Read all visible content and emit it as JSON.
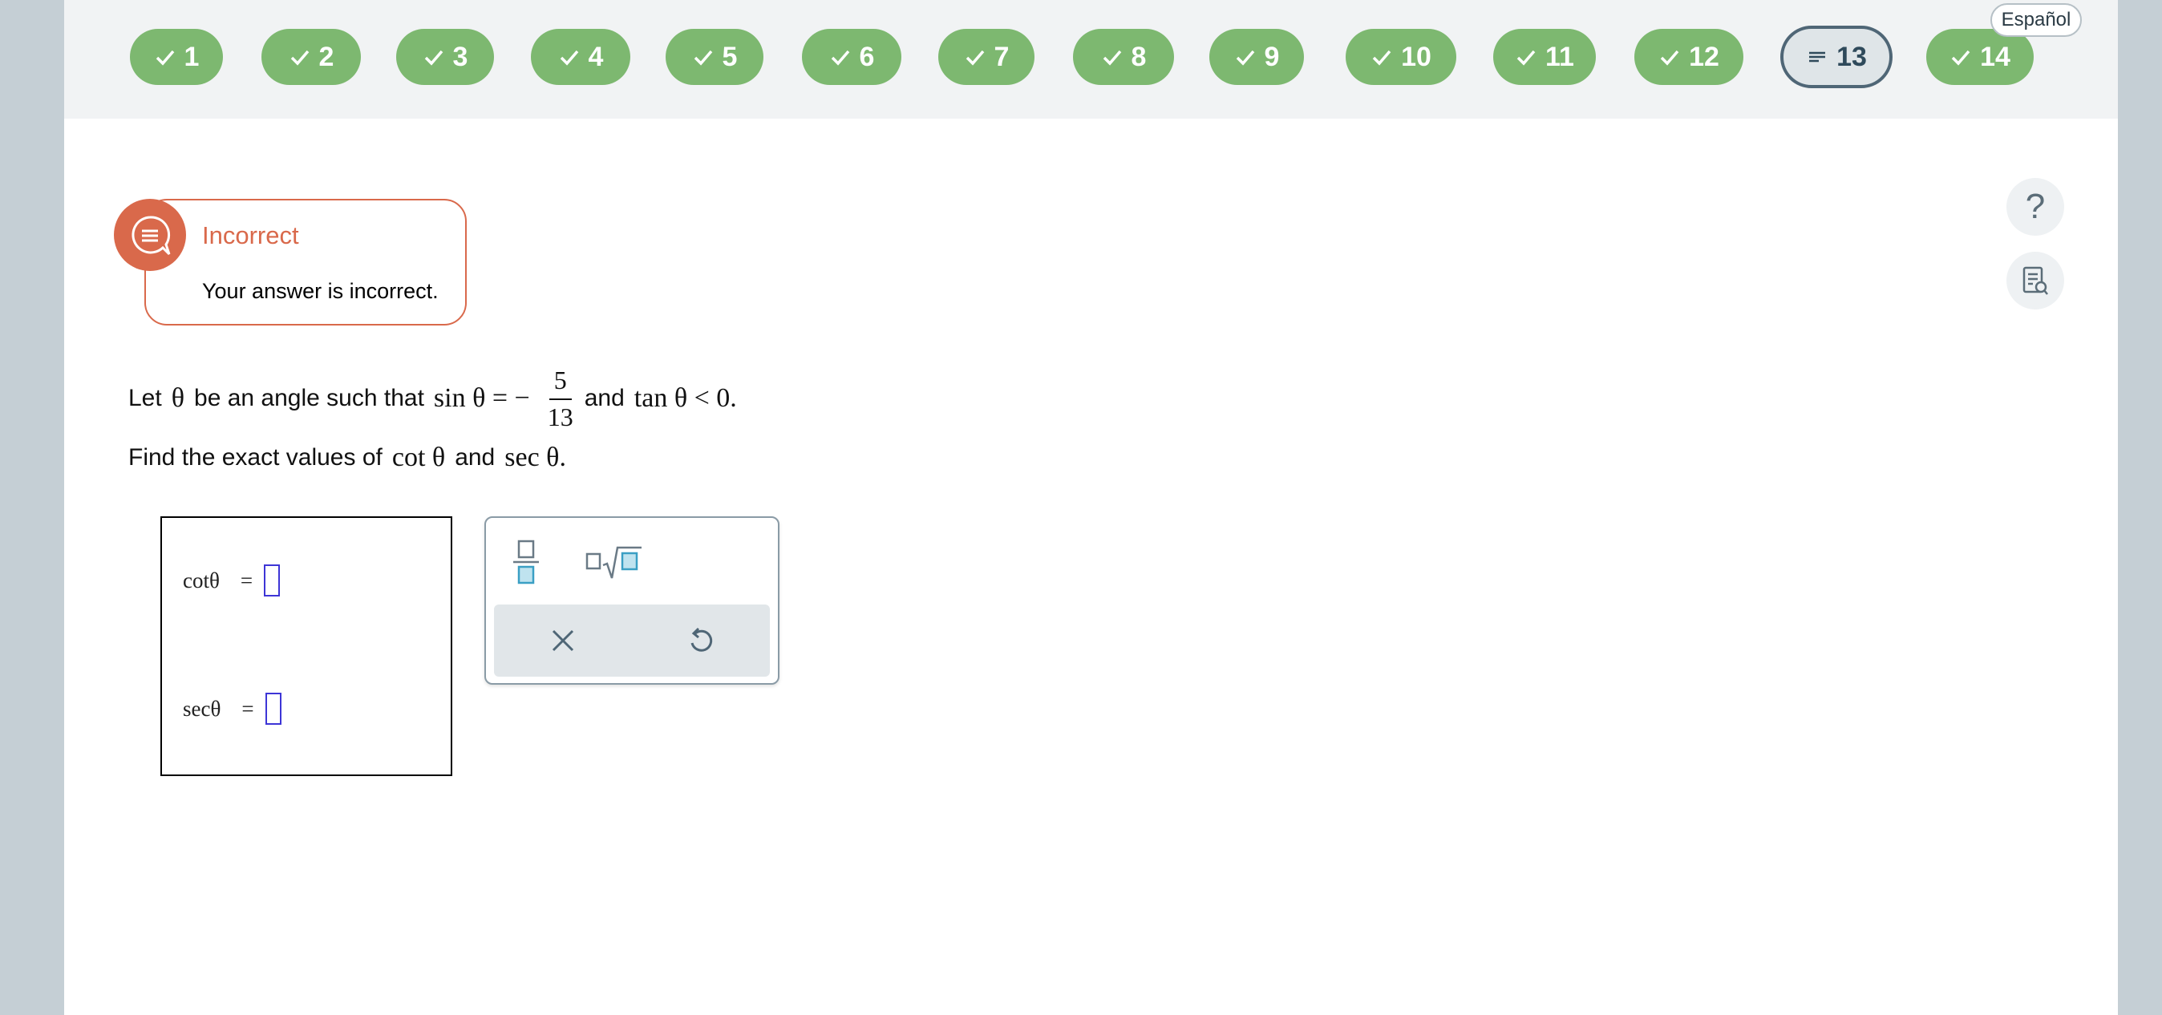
{
  "header": {
    "questions": [
      {
        "label": "1",
        "status": "correct"
      },
      {
        "label": "2",
        "status": "correct"
      },
      {
        "label": "3",
        "status": "correct"
      },
      {
        "label": "4",
        "status": "correct"
      },
      {
        "label": "5",
        "status": "correct"
      },
      {
        "label": "6",
        "status": "correct"
      },
      {
        "label": "7",
        "status": "correct"
      },
      {
        "label": "8",
        "status": "correct"
      },
      {
        "label": "9",
        "status": "correct"
      },
      {
        "label": "10",
        "status": "correct"
      },
      {
        "label": "11",
        "status": "correct"
      },
      {
        "label": "12",
        "status": "correct"
      },
      {
        "label": "13",
        "status": "current"
      },
      {
        "label": "14",
        "status": "correct"
      }
    ],
    "language_button": "Español"
  },
  "side": {
    "help_icon": "question-mark-icon",
    "notes_icon": "notes-search-icon"
  },
  "feedback": {
    "title": "Incorrect",
    "message": "Your answer is incorrect."
  },
  "question": {
    "line1_prefix": "Let",
    "theta": "θ",
    "line1_mid": "be an angle such that",
    "sin_expr": "sin θ = −",
    "frac_num": "5",
    "frac_den": "13",
    "and": "and",
    "tan_expr": "tan θ < 0.",
    "line2_prefix": "Find the exact values of",
    "cot_expr": "cot θ",
    "sec_expr": "sec θ."
  },
  "answers": {
    "cot_label": "cotθ",
    "sec_label": "secθ",
    "equals": "=",
    "cot_value": "",
    "sec_value": ""
  },
  "colors": {
    "correct_pill": "#7db870",
    "incorrect_accent": "#d9694b",
    "input_border": "#3d35d6"
  }
}
